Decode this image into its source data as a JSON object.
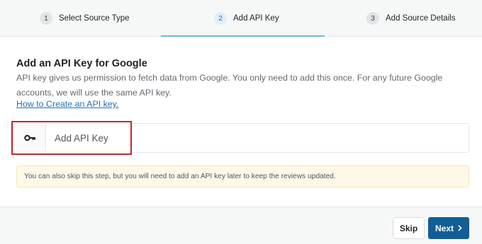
{
  "stepper": {
    "steps": [
      {
        "number": "1",
        "label": "Select Source Type"
      },
      {
        "number": "2",
        "label": "Add API Key"
      },
      {
        "number": "3",
        "label": "Add Source Details"
      }
    ],
    "active_step": 2
  },
  "main": {
    "heading": "Add an API Key for Google",
    "description": "API key gives us permission to fetch data from Google. You only need to add this once. For any future Google accounts, we will use the same API key.",
    "help_link": "How to Create an API key.",
    "api_input": {
      "placeholder": "Add API Key",
      "value": "",
      "icon": "key-icon"
    },
    "notice": "You can also skip this step, but you will need to add an API key later to keep the reviews updated."
  },
  "footer": {
    "skip_label": "Skip",
    "next_label": "Next",
    "next_icon": "chevron-right-icon"
  },
  "colors": {
    "primary": "#135e96",
    "link": "#2271b1",
    "highlight": "#c7252b",
    "notice_bg": "#fdf8e8",
    "active_step_line": "#6eb7d8"
  }
}
